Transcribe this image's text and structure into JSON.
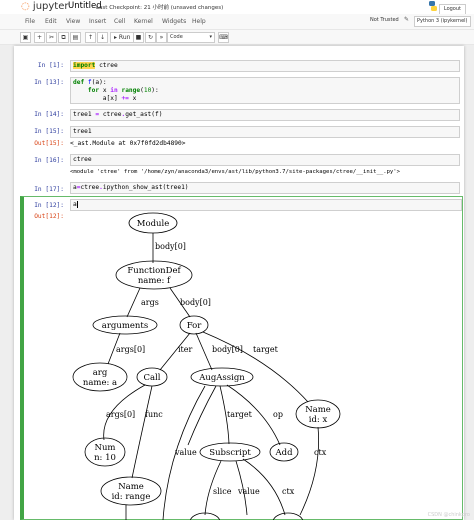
{
  "header": {
    "logo": "jupyter",
    "title": "Untitled",
    "checkpoint": "Last Checkpoint: 21 小时前",
    "unsaved": "(unsaved changes)",
    "logout": "Logout"
  },
  "menu": [
    "File",
    "Edit",
    "View",
    "Insert",
    "Cell",
    "Kernel",
    "Widgets",
    "Help"
  ],
  "status": {
    "trusted": "Not Trusted",
    "kernel": "Python 3 (ipykernel)"
  },
  "toolbar": {
    "run": "Run",
    "celltype": "Code"
  },
  "cells": [
    {
      "prompt": "In [1]:",
      "code": "import ctree"
    },
    {
      "prompt": "In [13]:",
      "code_lines": [
        "def f(a):",
        "    for x in range(10):",
        "        a[x] += x"
      ]
    },
    {
      "prompt": "In [14]:",
      "code": "tree1 = ctree.get_ast(f)"
    },
    {
      "prompt": "In [15]:",
      "code": "tree1",
      "out_prompt": "Out[15]:",
      "out": "<_ast.Module at 0x7f0fd2db4890>"
    },
    {
      "prompt": "In [16]:",
      "code": "ctree",
      "out": "<module 'ctree' from '/home/zyn/anaconda3/envs/ast/lib/python3.7/site-packages/ctree/__init__.py'>"
    },
    {
      "prompt": "In [17]:",
      "code": "a=ctree.ipython_show_ast(tree1)"
    },
    {
      "prompt": "In [12]:",
      "code": "a",
      "out_prompt": "Out[12]:"
    }
  ],
  "graph": {
    "nodes": [
      "Module",
      "FunctionDef",
      "name: f",
      "arguments",
      "For",
      "arg",
      "name: a",
      "Call",
      "AugAssign",
      "Name",
      "id: x",
      "Num",
      "n: 10",
      "Subscript",
      "Name",
      "id: range"
    ],
    "edges": [
      "body[0]",
      "args",
      "body[0]",
      "args[0]",
      "iter",
      "body[0]",
      "target",
      "args[0]",
      "func",
      "target",
      "op",
      "value",
      "ctx",
      "slice",
      "value",
      "ctx"
    ]
  },
  "watermark": "CSDN @chinkpro"
}
